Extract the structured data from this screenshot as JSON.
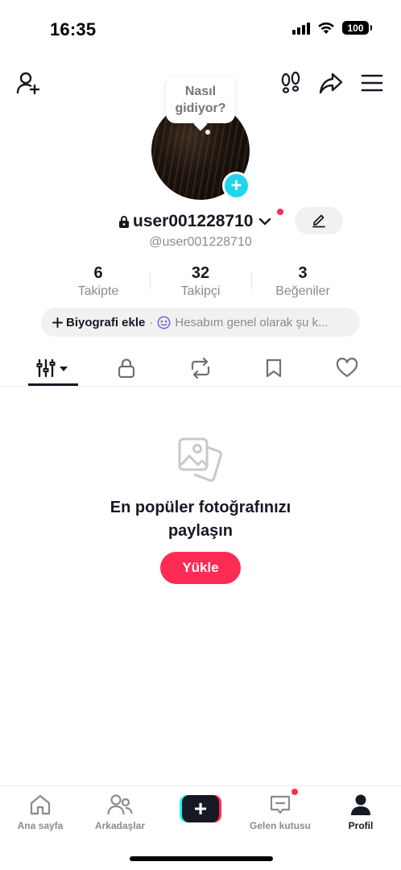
{
  "status_bar": {
    "time": "16:35",
    "battery": "100"
  },
  "profile": {
    "bubble_text": "Nasıl gidiyor?",
    "username": "user001228710",
    "handle": "@user001228710",
    "stats": [
      {
        "value": "6",
        "label": "Takipte"
      },
      {
        "value": "32",
        "label": "Takipçi"
      },
      {
        "value": "3",
        "label": "Beğeniler"
      }
    ],
    "bio_add": "Biyografi ekle",
    "bio_separator": "·",
    "bio_text": "Hesabım genel olarak şu k..."
  },
  "empty_state": {
    "title": "En popüler fotoğrafınızı paylaşın",
    "button": "Yükle"
  },
  "bottom_nav": {
    "items": [
      {
        "label": "Ana sayfa",
        "icon": "home-icon"
      },
      {
        "label": "Arkadaşlar",
        "icon": "friends-icon"
      },
      {
        "label": "",
        "icon": "create-icon"
      },
      {
        "label": "Gelen kutusu",
        "icon": "inbox-icon"
      },
      {
        "label": "Profil",
        "icon": "profile-icon"
      }
    ]
  },
  "colors": {
    "accent": "#fe2c55",
    "cyan": "#20d5ec",
    "text": "#161823",
    "muted": "#8a8b91"
  }
}
